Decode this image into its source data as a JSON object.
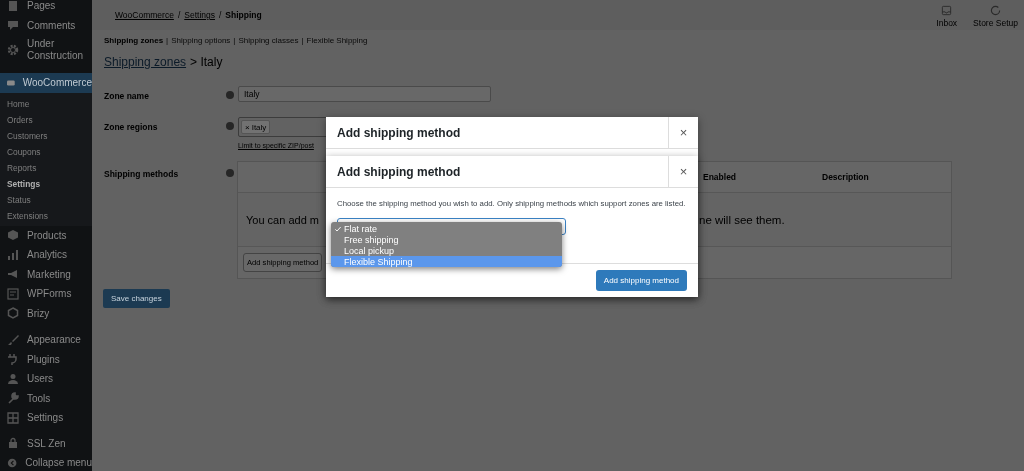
{
  "sidebar": {
    "groups": [
      [
        {
          "label": "Pages",
          "selected": false
        },
        {
          "label": "Comments",
          "selected": false
        },
        {
          "label": "Under Construction",
          "selected": false
        },
        {
          "label": "WooCommerce",
          "selected": true,
          "children": [
            {
              "label": "Home",
              "selected": false
            },
            {
              "label": "Orders",
              "selected": false
            },
            {
              "label": "Customers",
              "selected": false
            },
            {
              "label": "Coupons",
              "selected": false
            },
            {
              "label": "Reports",
              "selected": false
            },
            {
              "label": "Settings",
              "selected": true
            },
            {
              "label": "Status",
              "selected": false
            },
            {
              "label": "Extensions",
              "selected": false
            }
          ]
        },
        {
          "label": "Products",
          "selected": false
        },
        {
          "label": "Analytics",
          "selected": false
        },
        {
          "label": "Marketing",
          "selected": false
        },
        {
          "label": "WPForms",
          "selected": false
        },
        {
          "label": "Brizy",
          "selected": false
        }
      ],
      [
        {
          "label": "Appearance",
          "selected": false
        },
        {
          "label": "Plugins",
          "selected": false
        },
        {
          "label": "Users",
          "selected": false
        },
        {
          "label": "Tools",
          "selected": false
        },
        {
          "label": "Settings",
          "selected": false
        }
      ],
      [
        {
          "label": "SSL Zen",
          "selected": false
        },
        {
          "label": "Collapse menu",
          "selected": false
        }
      ]
    ]
  },
  "header": {
    "breadcrumb": {
      "separator": "/",
      "items": [
        {
          "label": "WooCommerce",
          "link": true
        },
        {
          "label": "Settings",
          "link": true
        },
        {
          "label": "Shipping",
          "link": false
        }
      ]
    },
    "actions": [
      {
        "label": "Inbox"
      },
      {
        "label": "Store Setup"
      }
    ]
  },
  "subnav": {
    "separator": "|",
    "tabs": [
      {
        "label": "Shipping zones",
        "selected": true
      },
      {
        "label": "Shipping options",
        "selected": false
      },
      {
        "label": "Shipping classes",
        "selected": false
      },
      {
        "label": "Flexible Shipping",
        "selected": false
      }
    ]
  },
  "title": {
    "link": "Shipping zones",
    "rest": "> Italy"
  },
  "zone_name": {
    "label": "Zone name",
    "value": "Italy"
  },
  "zone_regions": {
    "label": "Zone regions",
    "tags": [
      {
        "remove": "×",
        "label": "Italy"
      }
    ],
    "limit_link": "Limit to specific ZIP/post"
  },
  "shipping_methods": {
    "label": "Shipping methods",
    "columns": [
      "Enabled",
      "Description"
    ],
    "empty_left": "You can add m",
    "empty_right": "ne will see them.",
    "button": "Add shipping method"
  },
  "save_button": "Save changes",
  "modals": [
    {
      "title": "Add shipping method",
      "close": "×"
    },
    {
      "title": "Add shipping method",
      "close": "×",
      "description": "Choose the shipping method you wish to add. Only shipping methods which support zones are listed.",
      "options": [
        {
          "label": "Flat rate",
          "selected": true,
          "highlighted": false
        },
        {
          "label": "Free shipping",
          "selected": false,
          "highlighted": false
        },
        {
          "label": "Local pickup",
          "selected": false,
          "highlighted": false
        },
        {
          "label": "Flexible Shipping",
          "selected": false,
          "highlighted": true
        }
      ],
      "button": "Add shipping method"
    }
  ]
}
